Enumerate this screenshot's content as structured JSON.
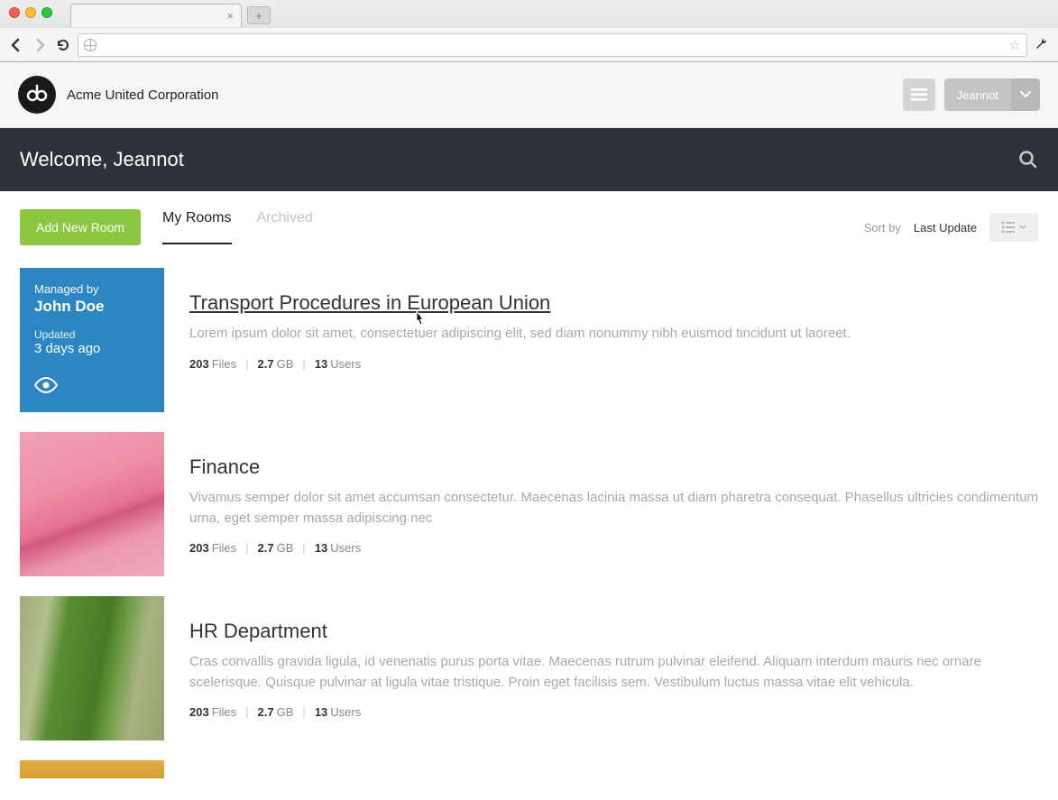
{
  "browser": {
    "tab_title": "",
    "url": ""
  },
  "header": {
    "company": "Acme United Corporation",
    "user": "Jeannot"
  },
  "welcome": {
    "text": "Welcome, Jeannot"
  },
  "controls": {
    "add_room": "Add New Room",
    "tabs": [
      "My Rooms",
      "Archived"
    ],
    "active_tab": 0,
    "sort_label": "Sort by",
    "sort_value": "Last Update"
  },
  "rooms": [
    {
      "thumb_type": "managed",
      "thumb_color": "blue",
      "managed_by_label": "Managed by",
      "managed_by": "John Doe",
      "updated_label": "Updated",
      "updated": "3 days ago",
      "title": "Transport Procedures in European Union",
      "hovered": true,
      "description": "Lorem ipsum dolor sit amet, consectetuer adipiscing elit, sed diam nonummy nibh euismod tincidunt ut laoreet.",
      "stats": {
        "files": "203",
        "files_label": "Files",
        "size": "2.7",
        "size_label": "GB",
        "users": "13",
        "users_label": "Users"
      }
    },
    {
      "thumb_type": "image",
      "thumb_color": "pink",
      "title": "Finance",
      "hovered": false,
      "description": "Vivamus semper dolor sit amet accumsan consectetur. Maecenas lacinia massa ut diam pharetra consequat. Phasellus ultricies condimentum urna, eget semper massa adipiscing nec",
      "stats": {
        "files": "203",
        "files_label": "Files",
        "size": "2.7",
        "size_label": "GB",
        "users": "13",
        "users_label": "Users"
      }
    },
    {
      "thumb_type": "image",
      "thumb_color": "green",
      "title": "HR Department",
      "hovered": false,
      "description": "Cras convallis gravida ligula, id venenatis purus porta vitae. Maecenas rutrum pulvinar eleifend. Aliquam interdum mauris nec ornare scelerisque. Quisque pulvinar at ligula vitae tristique. Proin eget facilisis sem. Vestibulum luctus massa vitae elit vehicula.",
      "stats": {
        "files": "203",
        "files_label": "Files",
        "size": "2.7",
        "size_label": "GB",
        "users": "13",
        "users_label": "Users"
      }
    }
  ]
}
